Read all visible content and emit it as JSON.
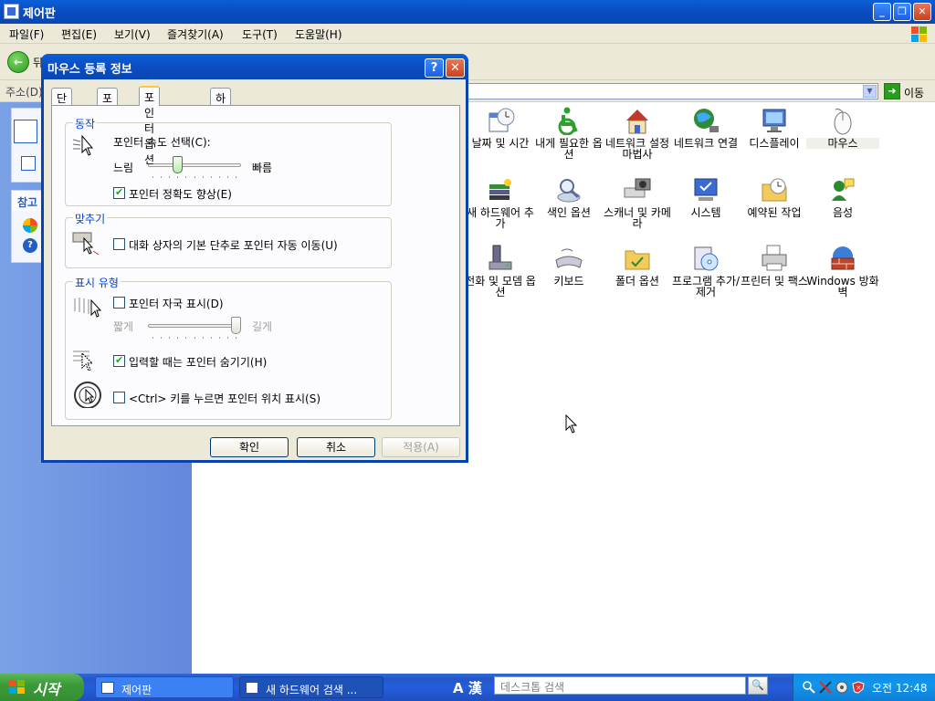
{
  "window": {
    "title": "제어판"
  },
  "menu": [
    "파일(F)",
    "편집(E)",
    "보기(V)",
    "즐겨찾기(A)",
    "도구(T)",
    "도움말(H)"
  ],
  "toolbar": {
    "back_label": "뒤"
  },
  "address": {
    "label": "주소(D)",
    "go_label": "이동"
  },
  "leftpane": {
    "section2_title": "참고"
  },
  "control_panel_items": [
    {
      "label": "날짜 및 시간",
      "icon": "date-time-icon"
    },
    {
      "label": "내게 필요한 옵션",
      "icon": "accessibility-icon"
    },
    {
      "label": "네트워크 설정 마법사",
      "icon": "network-wizard-icon"
    },
    {
      "label": "네트워크 연결",
      "icon": "network-connections-icon"
    },
    {
      "label": "디스플레이",
      "icon": "display-icon"
    },
    {
      "label": "마우스",
      "icon": "mouse-icon"
    },
    {
      "label": "새 하드웨어 추가",
      "icon": "add-hardware-icon"
    },
    {
      "label": "색인 옵션",
      "icon": "indexing-icon"
    },
    {
      "label": "스캐너 및 카메라",
      "icon": "scanner-camera-icon"
    },
    {
      "label": "시스템",
      "icon": "system-icon"
    },
    {
      "label": "예약된 작업",
      "icon": "scheduled-tasks-icon"
    },
    {
      "label": "음성",
      "icon": "speech-icon"
    },
    {
      "label": "전화 및 모뎀 옵션",
      "icon": "phone-modem-icon"
    },
    {
      "label": "키보드",
      "icon": "keyboard-icon"
    },
    {
      "label": "폴더 옵션",
      "icon": "folder-options-icon"
    },
    {
      "label": "프로그램 추가/제거",
      "icon": "add-remove-programs-icon"
    },
    {
      "label": "프린터 및 팩스",
      "icon": "printers-faxes-icon"
    },
    {
      "label": "Windows 방화벽",
      "icon": "firewall-icon"
    }
  ],
  "dialog": {
    "title": "마우스 등록 정보",
    "help_label": "?",
    "close_label": "✕",
    "tabs": [
      "단추",
      "포인터",
      "포인터 옵션",
      "하드웨어"
    ],
    "active_tab": "포인터 옵션",
    "groups": {
      "motion": {
        "title": "동작",
        "speed_label": "포인터 속도 선택(C):",
        "slow_label": "느림",
        "fast_label": "빠름",
        "speed_value_fraction": 0.3,
        "precision_label": "포인터 정확도 향상(E)",
        "precision_checked": true
      },
      "snap": {
        "title": "맞추기",
        "snap_label": "대화 상자의 기본 단추로 포인터 자동 이동(U)",
        "snap_checked": false
      },
      "visibility": {
        "title": "표시 유형",
        "trails_label": "포인터 자국 표시(D)",
        "trails_checked": false,
        "short_label": "짧게",
        "long_label": "길게",
        "trails_value_fraction": 1.0,
        "hide_label": "입력할 때는 포인터 숨기기(H)",
        "hide_checked": true,
        "ctrl_label": "<Ctrl> 키를 누르면 포인터 위치 표시(S)",
        "ctrl_checked": false
      }
    },
    "buttons": {
      "ok": "확인",
      "cancel": "취소",
      "apply": "적용(A)"
    }
  },
  "taskbar": {
    "start_label": "시작",
    "tasks": [
      "제어판",
      "새 하드웨어 검색 ..."
    ],
    "ime_label": "A 漢",
    "search_placeholder": "데스크톱 검색",
    "clock": "오전 12:48"
  },
  "colors": {
    "titlebar": "#0a5fd6",
    "group_title": "#0046d5",
    "start_green": "#3c9a38",
    "tray_blue": "#0f8ce8"
  }
}
